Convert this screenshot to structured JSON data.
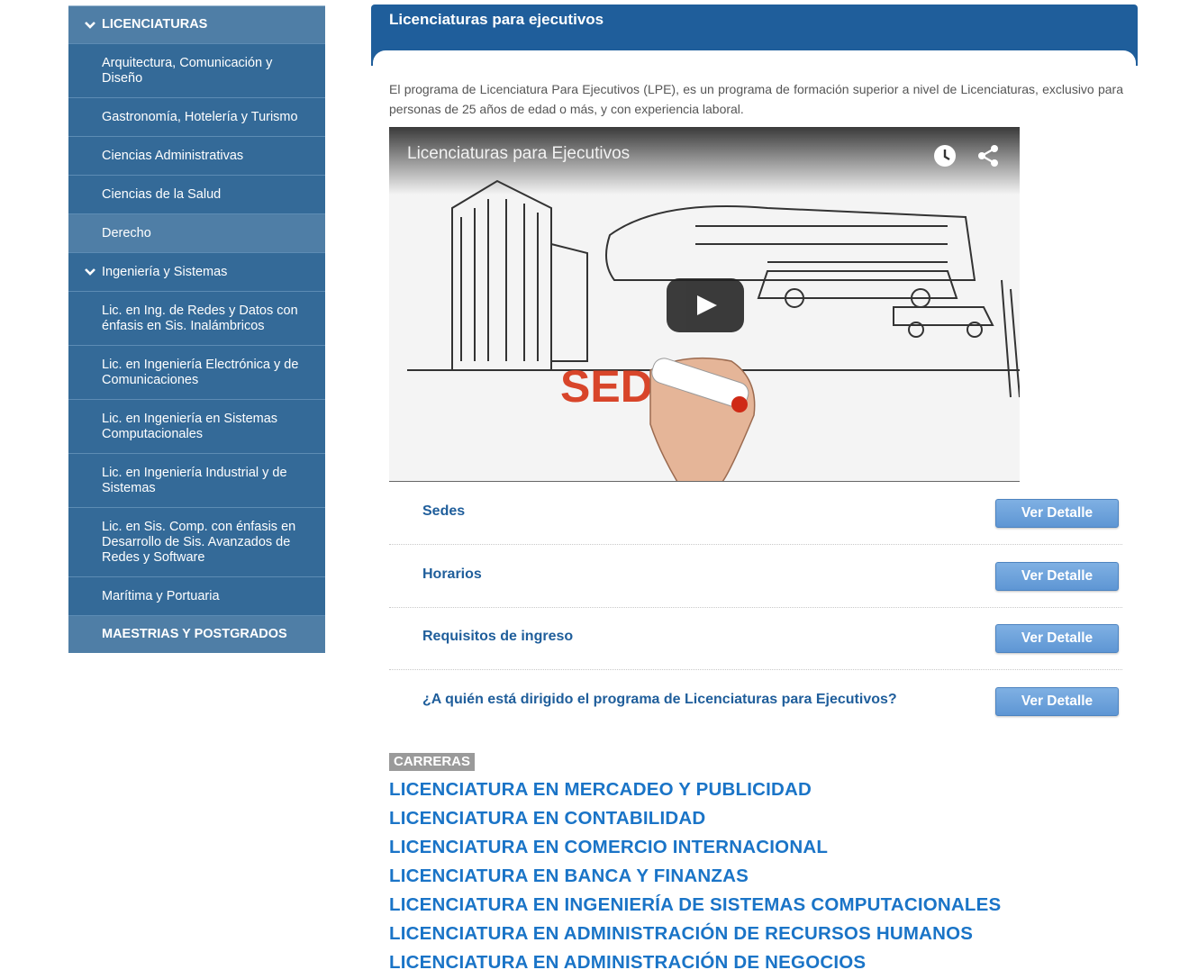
{
  "sidebar": {
    "header": "LICENCIATURAS",
    "items": [
      "Arquitectura, Comunicación y Diseño",
      "Gastronomía, Hotelería y Turismo",
      "Ciencias Administrativas",
      "Ciencias de la Salud",
      "Derecho",
      "Ingeniería y Sistemas",
      "Lic. en Ing. de Redes y Datos con énfasis en Sis. Inalámbricos",
      "Lic. en Ingeniería Electrónica y de Comunicaciones",
      "Lic. en Ingeniería en Sistemas Computacionales",
      "Lic. en Ingeniería Industrial y de Sistemas",
      "Lic. en Sis. Comp. con énfasis en Desarrollo de Sis. Avanzados de Redes y Software",
      "Marítima y Portuaria"
    ],
    "footer": "MAESTRIAS Y POSTGRADOS"
  },
  "main": {
    "title": "Licenciaturas para ejecutivos",
    "intro": "El programa de Licenciatura Para Ejecutivos (LPE), es un programa de formación superior a nivel de Licenciaturas, exclusivo para personas de 25 años de edad o más, y con experiencia laboral."
  },
  "video": {
    "title": "Licenciaturas para Ejecutivos",
    "sign_text": "SEDE",
    "controls": [
      "clock-icon",
      "share-icon",
      "play-icon"
    ]
  },
  "details": {
    "button_label": "Ver Detalle",
    "rows": [
      "Sedes",
      "Horarios",
      "Requisitos de ingreso",
      "¿A quién está dirigido el programa de Licenciaturas para Ejecutivos?"
    ]
  },
  "carreras": {
    "badge": "CARRERAS",
    "items": [
      "LICENCIATURA EN MERCADEO Y PUBLICIDAD",
      "LICENCIATURA EN CONTABILIDAD",
      "LICENCIATURA EN COMERCIO INTERNACIONAL",
      "LICENCIATURA EN BANCA Y FINANZAS",
      "LICENCIATURA EN INGENIERÍA DE SISTEMAS COMPUTACIONALES",
      "LICENCIATURA EN ADMINISTRACIÓN DE RECURSOS HUMANOS",
      "LICENCIATURA EN ADMINISTRACIÓN DE NEGOCIOS"
    ]
  },
  "colors": {
    "sidebar_bg": "#346a98",
    "sidebar_active": "#4f7ea6",
    "header_bar": "#1f5e9b",
    "link": "#1a74c7",
    "button": "#6aa1db"
  }
}
